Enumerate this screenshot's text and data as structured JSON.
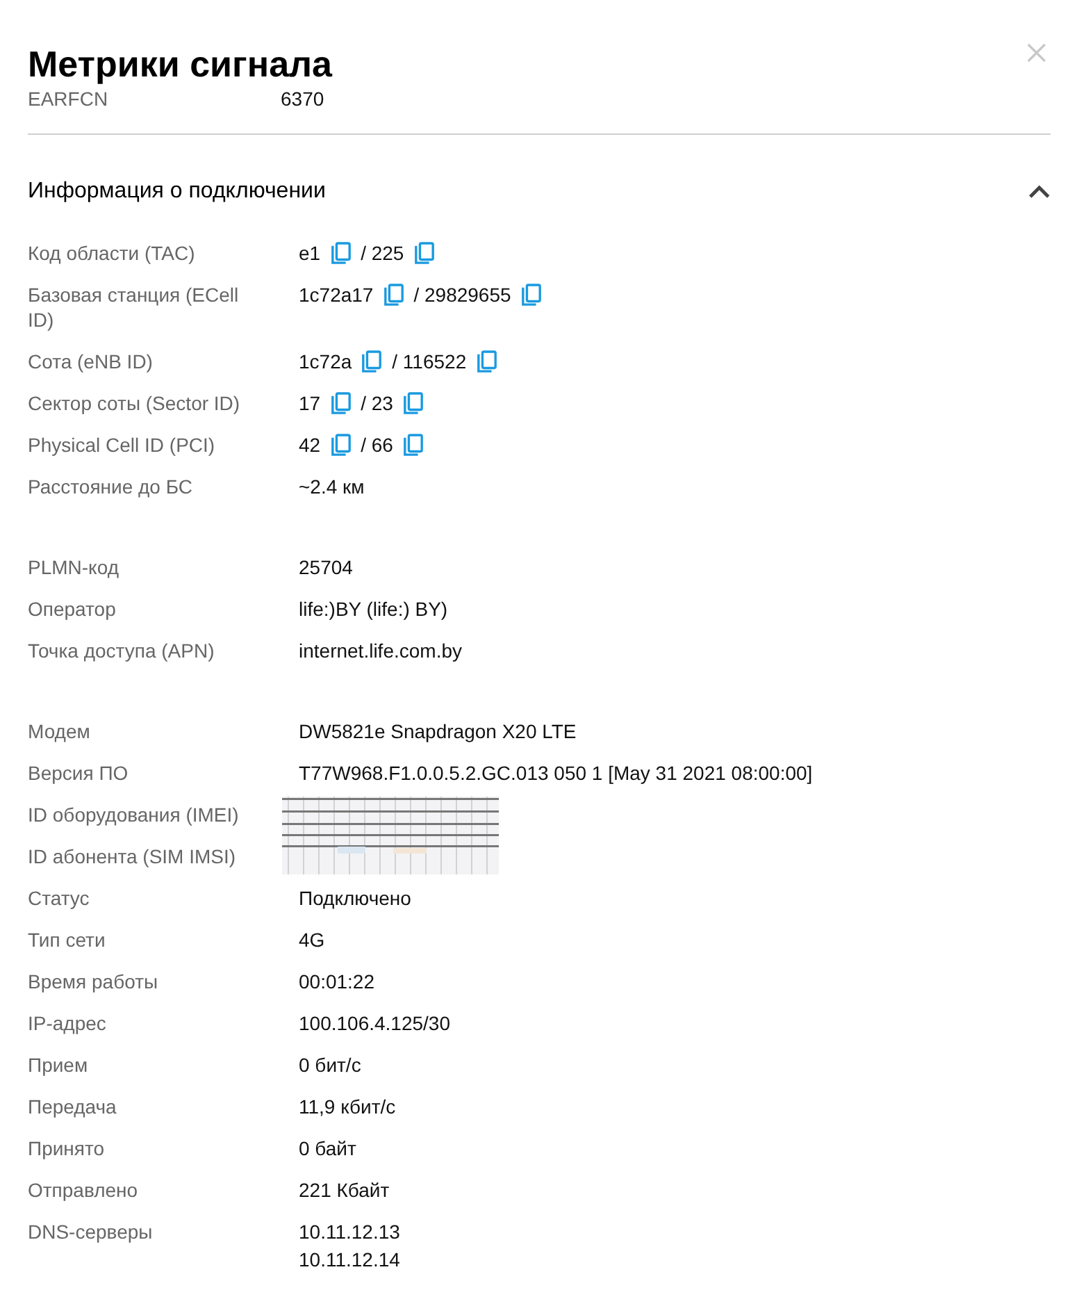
{
  "title": "Метрики сигнала",
  "header_row": {
    "label": "EARFCN",
    "value": "6370"
  },
  "section": {
    "title": "Информация о подключении",
    "expanded": true,
    "groups": [
      [
        {
          "kind": "copy",
          "label": "Код области (TAC)",
          "parts": [
            "e1",
            "/ 225"
          ]
        },
        {
          "kind": "copy",
          "label": "Базовая станция (ECell ID)",
          "parts": [
            "1c72a17",
            "/ 29829655"
          ]
        },
        {
          "kind": "copy",
          "label": "Сота (eNB ID)",
          "parts": [
            "1c72a",
            "/ 116522"
          ]
        },
        {
          "kind": "copy",
          "label": "Сектор соты (Sector ID)",
          "parts": [
            "17",
            "/ 23"
          ]
        },
        {
          "kind": "copy",
          "label": "Physical Cell ID (PCI)",
          "parts": [
            "42",
            "/ 66"
          ]
        },
        {
          "kind": "text",
          "label": "Расстояние до БС",
          "values": [
            "~2.4 км"
          ]
        }
      ],
      [
        {
          "kind": "text",
          "label": "PLMN-код",
          "values": [
            "25704"
          ]
        },
        {
          "kind": "text",
          "label": "Оператор",
          "values": [
            "life:)BY (life:) BY)"
          ]
        },
        {
          "kind": "text",
          "label": "Точка доступа (APN)",
          "values": [
            "internet.life.com.by"
          ]
        }
      ],
      [
        {
          "kind": "text",
          "label": "Модем",
          "values": [
            "DW5821e Snapdragon X20 LTE"
          ]
        },
        {
          "kind": "text",
          "label": "Версия ПО",
          "values": [
            "T77W968.F1.0.0.5.2.GC.013 050 1 [May 31 2021 08:00:00]"
          ]
        },
        {
          "kind": "redacted",
          "labels": [
            "ID оборудования (IMEI)",
            "ID абонента (SIM IMSI)"
          ]
        },
        {
          "kind": "text",
          "label": "Статус",
          "values": [
            "Подключено"
          ]
        },
        {
          "kind": "text",
          "label": "Тип сети",
          "values": [
            "4G"
          ]
        },
        {
          "kind": "text",
          "label": "Время работы",
          "values": [
            "00:01:22"
          ]
        },
        {
          "kind": "text",
          "label": "IP-адрес",
          "values": [
            "100.106.4.125/30"
          ]
        },
        {
          "kind": "text",
          "label": "Прием",
          "values": [
            "0 бит/с"
          ]
        },
        {
          "kind": "text",
          "label": "Передача",
          "values": [
            "11,9 кбит/с"
          ]
        },
        {
          "kind": "text",
          "label": "Принято",
          "values": [
            "0 байт"
          ]
        },
        {
          "kind": "text",
          "label": "Отправлено",
          "values": [
            "221 Кбайт"
          ]
        },
        {
          "kind": "text",
          "label": "DNS-серверы",
          "values": [
            "10.11.12.13",
            "10.11.12.14"
          ]
        }
      ]
    ]
  }
}
